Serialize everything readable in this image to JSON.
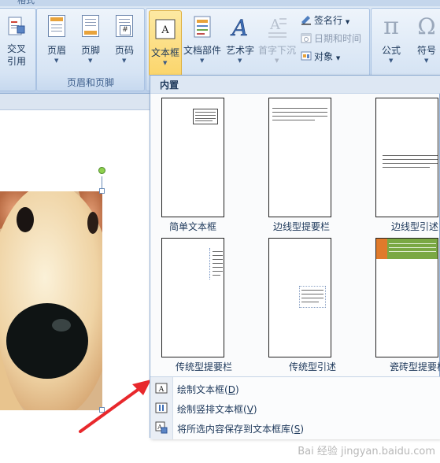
{
  "ribbon": {
    "title_fragment": "格式",
    "cross_ref": {
      "label_line1": "交叉",
      "label_line2": "引用"
    },
    "header_footer_group": {
      "label": "页眉和页脚",
      "buttons": [
        {
          "label": "页眉"
        },
        {
          "label": "页脚"
        },
        {
          "label": "页码"
        }
      ]
    },
    "text_group": {
      "buttons": [
        {
          "label": "文本框"
        },
        {
          "label": "文档部件"
        },
        {
          "label": "艺术字"
        },
        {
          "label": "首字下沉"
        }
      ],
      "small_buttons": [
        {
          "label": "签名行",
          "enabled": true
        },
        {
          "label": "日期和时间",
          "enabled": false
        },
        {
          "label": "对象",
          "enabled": true
        }
      ]
    },
    "symbols_group": {
      "buttons": [
        {
          "label": "公式"
        },
        {
          "label": "符号"
        }
      ]
    }
  },
  "dropdown": {
    "section_header": "内置",
    "gallery": [
      {
        "label": "简单文本框"
      },
      {
        "label": "边线型提要栏"
      },
      {
        "label": "边线型引述"
      },
      {
        "label": "传统型提要栏"
      },
      {
        "label": "传统型引述"
      },
      {
        "label": "瓷砖型提要栏"
      }
    ],
    "commands": [
      {
        "text": "绘制文本框(",
        "key": "D",
        "close": ")"
      },
      {
        "text": "绘制竖排文本框(",
        "key": "V",
        "close": ")"
      },
      {
        "text": "将所选内容保存到文本框库(",
        "key": "S",
        "close": ")"
      }
    ]
  },
  "watermark": "Bai 经验 jingyan.baidu.com",
  "colors": {
    "accent_orange": "#e8a33b",
    "tile_green": "#7aa843",
    "tile_orange": "#e07a2b",
    "arrow_red": "#e8282c"
  }
}
